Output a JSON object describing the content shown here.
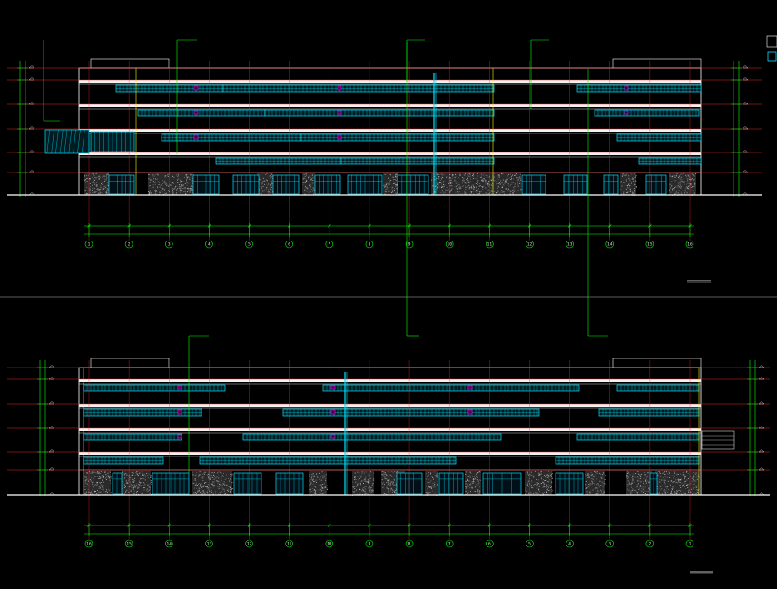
{
  "drawing": {
    "background": "#000000",
    "colors": {
      "frame": "#ffffff",
      "window": "#00e5ff",
      "axis": "#ff2a2a",
      "dimension": "#00ff00",
      "column": "#ffff00",
      "stone": "#9a9a9a",
      "accent": "#ff00ff",
      "leader": "#00ff00",
      "divider": "#7a7a7a"
    },
    "elevations": [
      {
        "name": "elevation-top",
        "grid_labels": [
          "1",
          "2",
          "3",
          "4",
          "5",
          "6",
          "7",
          "8",
          "9",
          "10",
          "11",
          "12",
          "13",
          "14",
          "15",
          "16"
        ],
        "title": "",
        "scale": ""
      },
      {
        "name": "elevation-bottom",
        "grid_labels": [
          "16",
          "15",
          "14",
          "13",
          "12",
          "11",
          "10",
          "9",
          "8",
          "7",
          "6",
          "5",
          "4",
          "3",
          "2",
          "1"
        ],
        "title": "",
        "scale": ""
      }
    ],
    "legend_icons": [
      "layer-swatch-icon",
      "layer-swatch-icon"
    ]
  }
}
